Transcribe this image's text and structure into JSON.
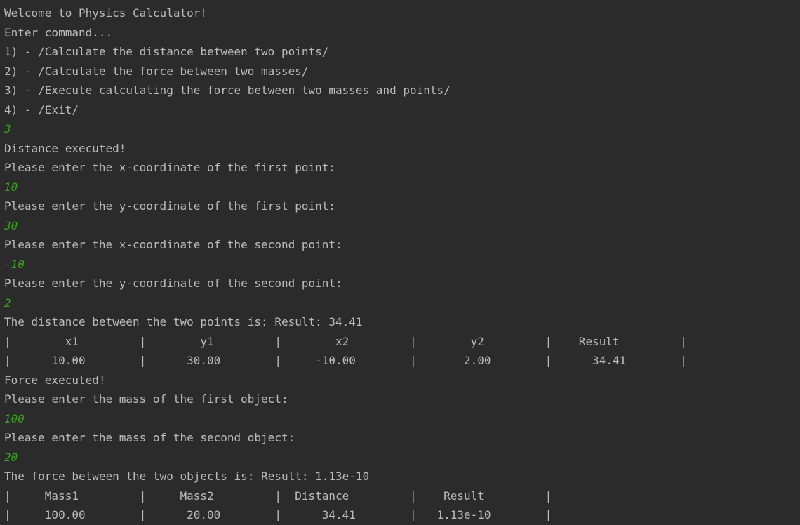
{
  "console": {
    "colors": {
      "background": "#2b2b2b",
      "output_text": "#bbbbbb",
      "user_input": "#3a9d23"
    },
    "lines": [
      {
        "type": "output",
        "text": "Welcome to Physics Calculator!"
      },
      {
        "type": "output",
        "text": "Enter command..."
      },
      {
        "type": "output",
        "text": "1) - /Calculate the distance between two points/"
      },
      {
        "type": "output",
        "text": "2) - /Calculate the force between two masses/"
      },
      {
        "type": "output",
        "text": "3) - /Execute calculating the force between two masses and points/"
      },
      {
        "type": "output",
        "text": "4) - /Exit/"
      },
      {
        "type": "input",
        "text": "3"
      },
      {
        "type": "output",
        "text": "Distance executed!"
      },
      {
        "type": "output",
        "text": "Please enter the x-coordinate of the first point:"
      },
      {
        "type": "input",
        "text": "10"
      },
      {
        "type": "output",
        "text": "Please enter the y-coordinate of the first point:"
      },
      {
        "type": "input",
        "text": "30"
      },
      {
        "type": "output",
        "text": "Please enter the x-coordinate of the second point:"
      },
      {
        "type": "input",
        "text": "-10"
      },
      {
        "type": "output",
        "text": "Please enter the y-coordinate of the second point:"
      },
      {
        "type": "input",
        "text": "2"
      },
      {
        "type": "output",
        "text": "The distance between the two points is: Result: 34.41"
      },
      {
        "type": "output",
        "text": "|        x1         |        y1         |        x2         |        y2         |    Result         |"
      },
      {
        "type": "output",
        "text": "|      10.00        |      30.00        |     -10.00        |       2.00        |      34.41        |"
      },
      {
        "type": "output",
        "text": "Force executed!"
      },
      {
        "type": "output",
        "text": "Please enter the mass of the first object:"
      },
      {
        "type": "input",
        "text": "100"
      },
      {
        "type": "output",
        "text": "Please enter the mass of the second object:"
      },
      {
        "type": "input",
        "text": "20"
      },
      {
        "type": "output",
        "text": "The force between the two objects is: Result: 1.13e-10"
      },
      {
        "type": "output",
        "text": "|     Mass1         |     Mass2         |  Distance         |    Result         |"
      },
      {
        "type": "output",
        "text": "|     100.00        |      20.00        |      34.41        |   1.13e-10        |"
      }
    ]
  }
}
